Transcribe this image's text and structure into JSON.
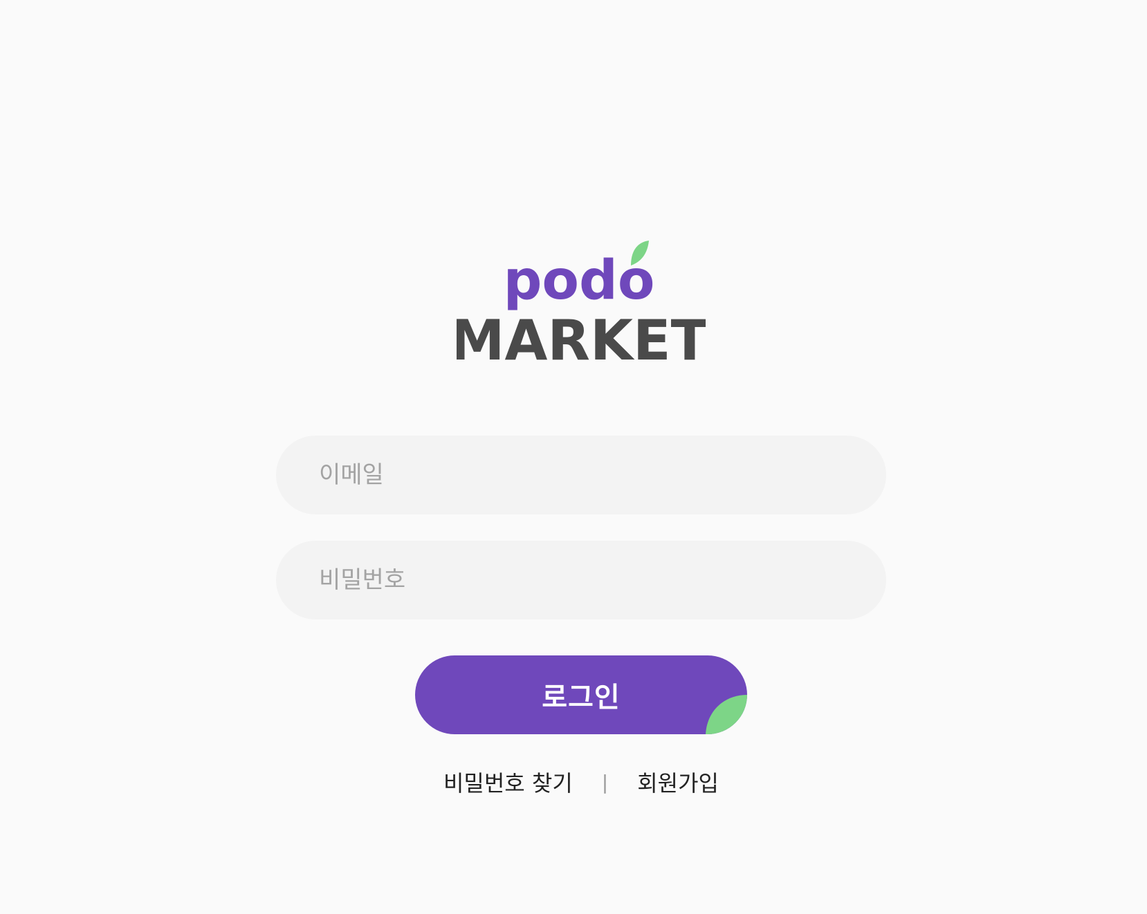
{
  "brand": {
    "logo_top": "podo",
    "logo_bottom": "MARKET",
    "primary_color": "#6f48bb",
    "accent_color": "#7dd587",
    "text_color": "#4a4a4a"
  },
  "form": {
    "email_placeholder": "이메일",
    "password_placeholder": "비밀번호",
    "login_label": "로그인"
  },
  "links": {
    "find_password": "비밀번호 찾기",
    "separator": "|",
    "signup": "회원가입"
  },
  "icons": [
    "leaf-icon",
    "leaf-corner-icon"
  ]
}
